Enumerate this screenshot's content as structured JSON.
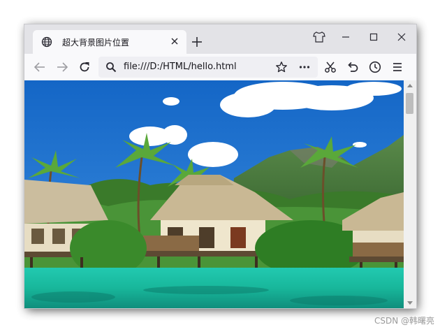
{
  "colors": {
    "titlebar_bg": "#e3e3e7",
    "toolbar_bg": "#f9f9fb",
    "urlbar_bg": "#efeff3",
    "icon": "#2b2a33",
    "icon_disabled": "#9e9ea3"
  },
  "tab": {
    "title": "超大背景图片位置",
    "icon": "globe-icon",
    "close_icon": "close-icon"
  },
  "toolbar": {
    "back_icon": "back-arrow-icon",
    "forward_icon": "forward-arrow-icon",
    "reload_icon": "reload-icon",
    "url": "file:///D:/HTML/hello.html",
    "bookmark_icon": "star-icon",
    "more_icon": "more-dots-icon",
    "extra_icons": [
      "scissors-icon",
      "undo-icon",
      "history-clock-icon",
      "menu-icon"
    ]
  },
  "window_controls": [
    "tshirt-icon",
    "minimize-icon",
    "maximize-icon",
    "close-icon"
  ],
  "content": {
    "image": "tropical-beach-bungalows-image"
  },
  "watermark": "CSDN @韩曙亮"
}
